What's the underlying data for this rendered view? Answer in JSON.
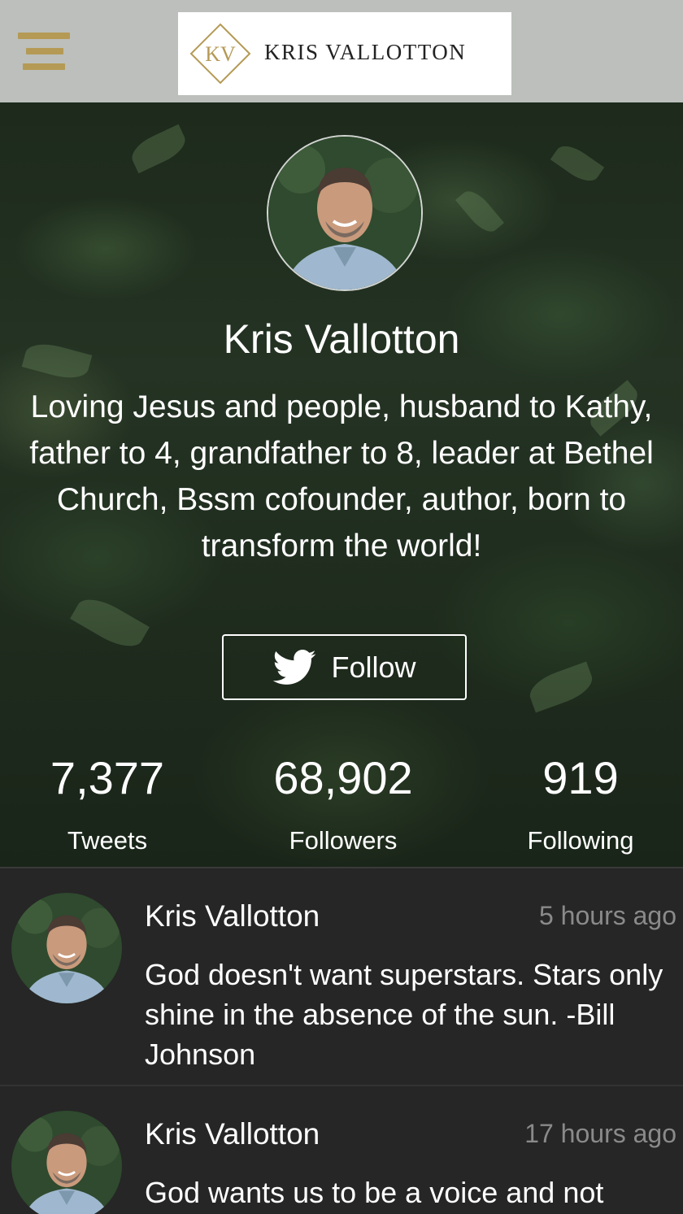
{
  "header": {
    "menu_icon": "hamburger-menu-icon",
    "logo_monogram": "KV",
    "logo_text": "KRIS VALLOTTON",
    "accent_color": "#b59a55"
  },
  "profile": {
    "name": "Kris Vallotton",
    "bio": "Loving Jesus and people, husband to Kathy, father to 4, grandfather to 8, leader at Bethel Church, Bssm cofounder, author, born to transform the world!",
    "follow_label": "Follow",
    "follow_icon": "twitter-bird-icon",
    "stats": {
      "tweets": {
        "value": "7,377",
        "label": "Tweets"
      },
      "followers": {
        "value": "68,902",
        "label": "Followers"
      },
      "following": {
        "value": "919",
        "label": "Following"
      }
    }
  },
  "tweets": [
    {
      "author": "Kris Vallotton",
      "time": "5 hours ago",
      "text": "God doesn't want superstars. Stars only shine in the absence of the sun. -Bill Johnson"
    },
    {
      "author": "Kris Vallotton",
      "time": "17 hours ago",
      "text": "God wants us to be a voice and not"
    }
  ]
}
